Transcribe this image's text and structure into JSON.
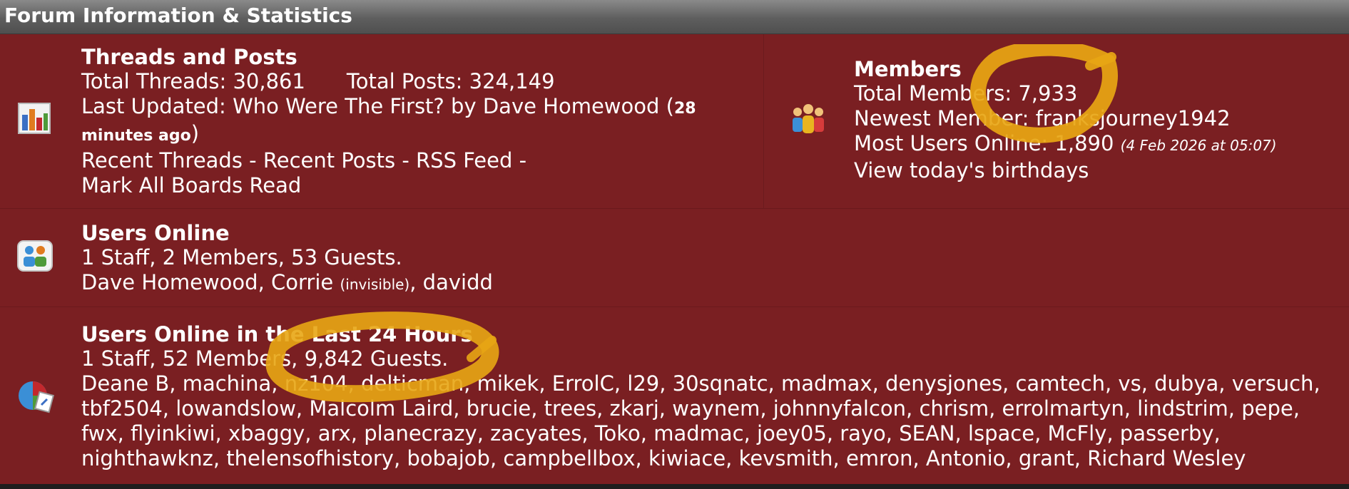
{
  "header": {
    "title": "Forum Information & Statistics"
  },
  "threads": {
    "title": "Threads and Posts",
    "total_threads": "Total Threads: 30,861",
    "total_posts": "Total Posts: 324,149",
    "last_updated_prefix": "Last Updated: ",
    "last_updated_link": "Who Were The First?",
    "last_updated_by": " by ",
    "last_updated_user": "Dave Homewood",
    "time_open": " (",
    "time_ago": "28 minutes ago",
    "time_close": ")",
    "links": [
      "Recent Threads",
      "Recent Posts",
      "RSS Feed",
      "Mark All Boards Read"
    ],
    "separator": " - "
  },
  "members": {
    "title": "Members",
    "total_members_label": "Total Members: ",
    "total_members_value": "7,933",
    "newest_label": "Newest Member: ",
    "newest_value": "franksjourney1942",
    "most_online_label": "Most Users Online: ",
    "most_online_value": "1,890",
    "most_online_date": "(4 Feb 2026 at 05:07)",
    "birthdays_link": "View today's birthdays"
  },
  "online": {
    "title": "Users Online",
    "summary": "1 Staff, 2 Members, 53 Guests.",
    "user1": "Dave Homewood",
    "user2": "Corrie",
    "invisible_note": "(invisible)",
    "user3": "davidd",
    "sep": ", "
  },
  "online24": {
    "title": "Users Online in the Last 24 Hours",
    "summary": "1 Staff, 52 Members, 9,842 Guests.",
    "lines": [
      "Deane B, machina, nz104, delticman, mikek, ErrolC, l29, 30sqnatc, madmax, denysjones, camtech, vs, dubya, versuch,",
      "tbf2504, lowandslow, Malcolm Laird, brucie, trees, zkarj, waynem, johnnyfalcon, chrism, errolmartyn, lindstrim, pepe,",
      "fwx, flyinkiwi, xbaggy, arx, planecrazy, zacyates, Toko, madmac, joey05, rayo, SEAN, lspace, McFly, passerby,",
      "nighthawknz, thelensofhistory, bobajob, campbellbox, kiwiace, kevsmith, emron, Antonio, grant, Richard Wesley"
    ]
  },
  "colors": {
    "panel": "#7a1f22",
    "header": "#5e5e5e",
    "highlight": "#e8a614"
  },
  "icons": [
    "stats-icon",
    "members-icon",
    "users-online-icon",
    "users-24h-icon"
  ]
}
